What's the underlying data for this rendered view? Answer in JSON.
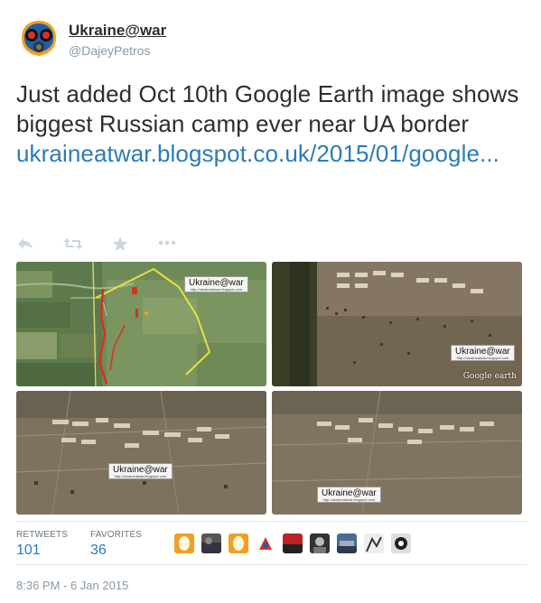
{
  "user": {
    "display_name": "Ukraine@war",
    "handle": "@DajeyPetros",
    "avatar_icon": "gas-mask-icon"
  },
  "tweet": {
    "text": "Just added Oct 10th Google Earth image shows biggest Russian camp ever near UA border",
    "link_text": "ukraineatwar.blogspot.co.uk/2015/01/google..."
  },
  "actions": {
    "reply_icon": "reply-icon",
    "retweet_icon": "retweet-icon",
    "favorite_icon": "star-icon",
    "more_icon": "more-dots-icon",
    "icon_color": "#ccd6dd"
  },
  "media": {
    "watermark_title": "Ukraine@war",
    "watermark_url": "http://ukraineatwar.blogspot.com",
    "google_earth_label": "Google earth"
  },
  "stats": {
    "retweets_label": "RETWEETS",
    "retweets_count": "101",
    "favorites_label": "FAVORITES",
    "favorites_count": "36"
  },
  "timestamp": "8:36 PM - 6 Jan 2015",
  "colors": {
    "text": "#292f33",
    "link": "#2b7bb9",
    "muted": "#8899a6",
    "label": "#66757f",
    "divider": "#e1e8ed"
  }
}
